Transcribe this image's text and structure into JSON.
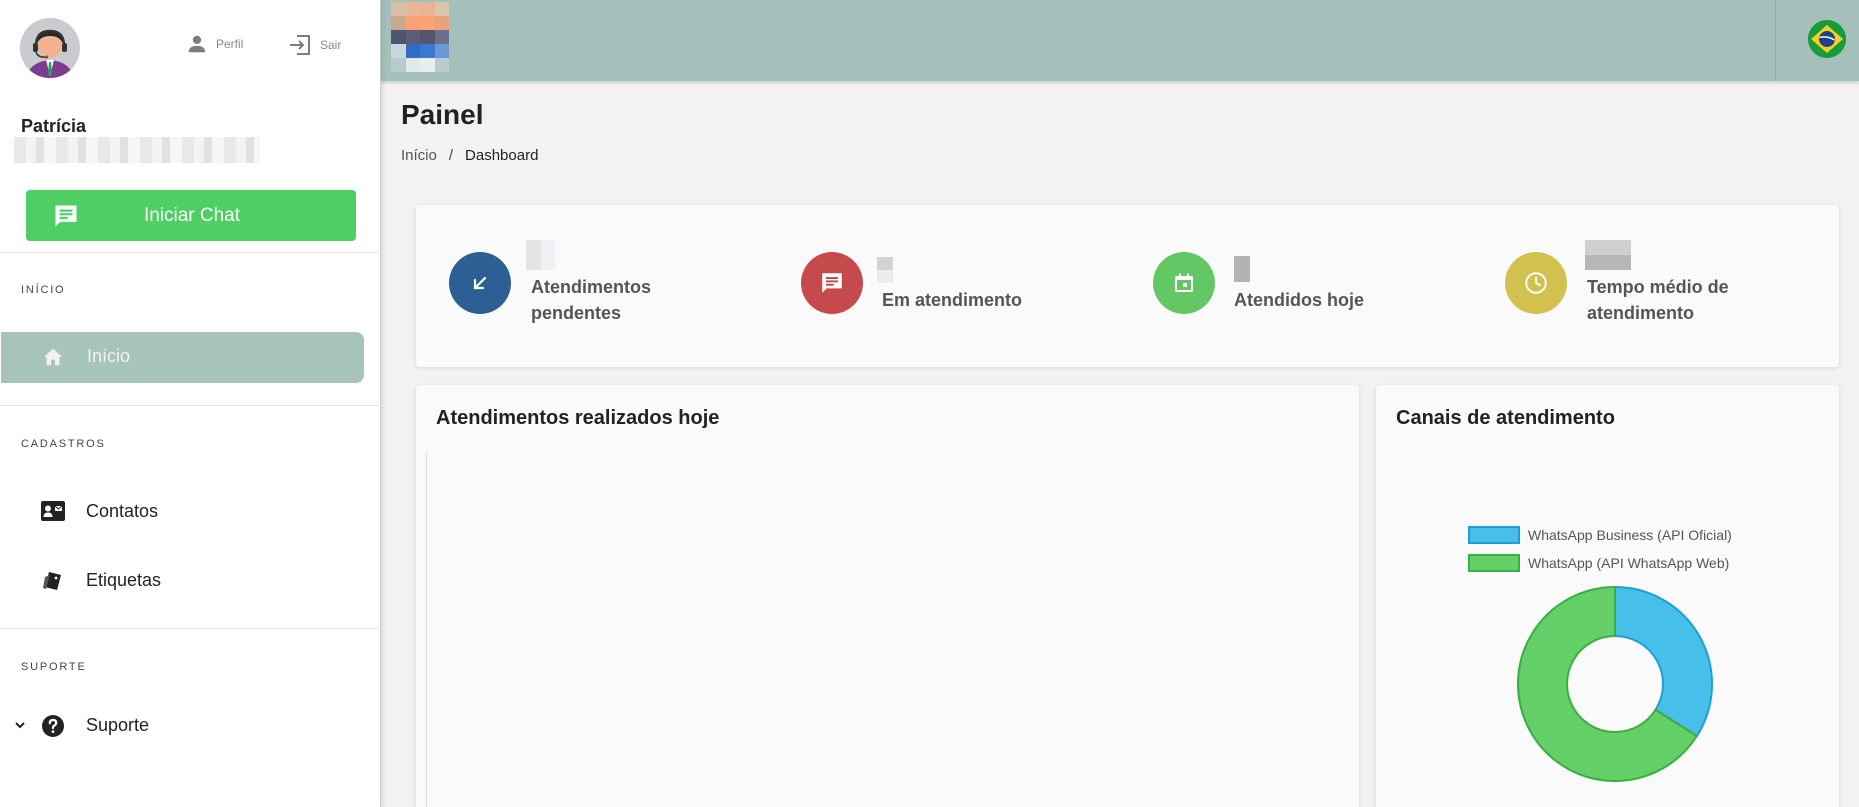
{
  "sidebar": {
    "user_name": "Patrícia",
    "profile_label": "Perfil",
    "logout_label": "Sair",
    "chat_button": "Iniciar Chat",
    "sections": {
      "inicio": "INÍCIO",
      "cadastros": "CADASTROS",
      "suporte": "SUPORTE"
    },
    "items": {
      "inicio": "Início",
      "contatos": "Contatos",
      "etiquetas": "Etiquetas",
      "suporte": "Suporte"
    }
  },
  "header": {
    "flag": "brazil-flag-icon"
  },
  "page": {
    "title": "Painel",
    "breadcrumb": {
      "home": "Início",
      "separator": "/",
      "current": "Dashboard"
    }
  },
  "stats": [
    {
      "label_line1": "Atendimentos",
      "label_line2": "pendentes",
      "color": "#2c5f93",
      "icon": "arrow-down-left-icon"
    },
    {
      "label_line1": "Em atendimento",
      "label_line2": "",
      "color": "#c6494b",
      "icon": "message-icon"
    },
    {
      "label_line1": "Atendidos hoje",
      "label_line2": "",
      "color": "#63c863",
      "icon": "calendar-icon"
    },
    {
      "label_line1": "Tempo médio de",
      "label_line2": "atendimento",
      "color": "#d2c14f",
      "icon": "clock-icon"
    }
  ],
  "panels": {
    "today": "Atendimentos realizados hoje",
    "channels": "Canais de atendimento"
  },
  "chart_data": {
    "type": "pie",
    "series": [
      {
        "name": "WhatsApp Business (API Oficial)",
        "value": 34,
        "color": "#47bfeb"
      },
      {
        "name": "WhatsApp (API WhatsApp Web)",
        "value": 66,
        "color": "#65cf67"
      }
    ],
    "legend": "top"
  },
  "colors": {
    "accent_green": "#4dcf63",
    "header": "#a5c0bb",
    "active_item": "#a6c3bc"
  }
}
